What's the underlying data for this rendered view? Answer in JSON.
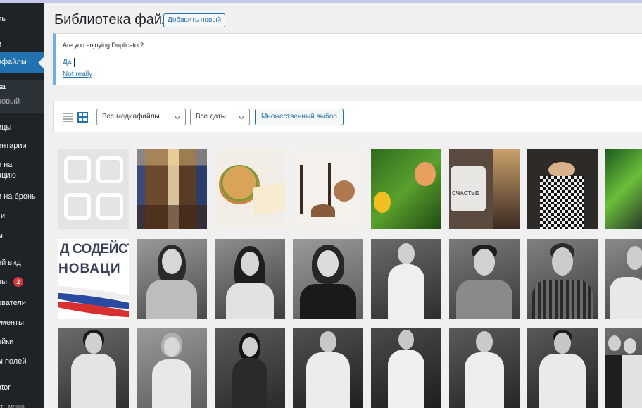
{
  "sidebar": {
    "items": [
      {
        "label": "ль"
      },
      {
        "label": "и"
      },
      {
        "label": "афайлы"
      },
      {
        "label": "ка"
      },
      {
        "label": "новый"
      },
      {
        "label": "ицы"
      },
      {
        "label": "ентарии"
      },
      {
        "label": "и на"
      },
      {
        "label": "ацию"
      },
      {
        "label": "и на бронь"
      },
      {
        "label": "ти"
      },
      {
        "label": "ы"
      },
      {
        "label": "ий вид"
      },
      {
        "label": "ны",
        "badge": "2"
      },
      {
        "label": "ователи"
      },
      {
        "label": "ументы"
      },
      {
        "label": "ойки"
      },
      {
        "label": "ы полей"
      },
      {
        "label": "ator"
      },
      {
        "label": "уть меню"
      }
    ]
  },
  "header": {
    "title": "Библиотека файлов",
    "add_new": "Добавить новый"
  },
  "notice": {
    "question": "Are you enjoying Duplicator?",
    "yes": "Да",
    "no": "Not really"
  },
  "toolbar": {
    "media_filter": "Все медиафайлы",
    "date_filter": "Все даты",
    "bulk_select": "Множественный выбор"
  },
  "grid": {
    "banner_line1": "Д СОДЕЙСТ",
    "banner_line2": "НОВАЦИ",
    "mug_text": "СЧАСТЬЕ"
  },
  "colors": {
    "accent": "#2271b1",
    "sidebar_bg": "#1d2327",
    "badge": "#d63638"
  }
}
